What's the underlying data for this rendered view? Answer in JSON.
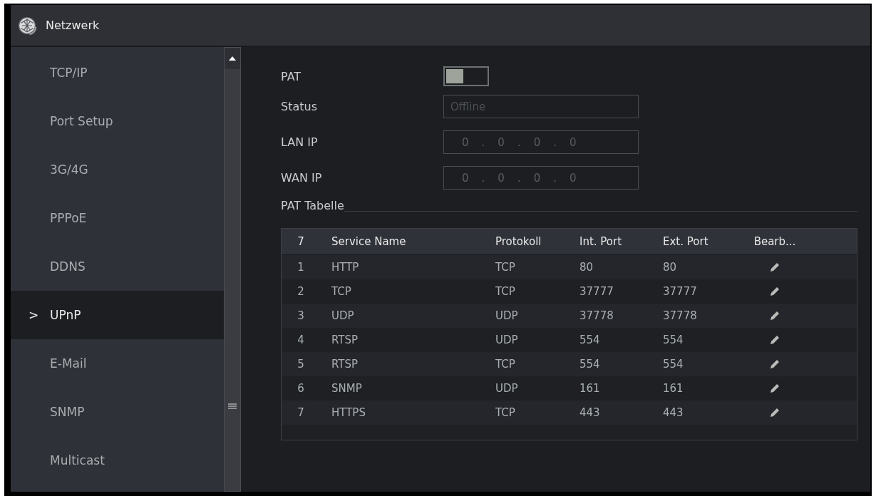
{
  "window": {
    "title": "Netzwerk"
  },
  "sidebar": {
    "items": [
      {
        "label": "TCP/IP",
        "selected": false
      },
      {
        "label": "Port Setup",
        "selected": false
      },
      {
        "label": "3G/4G",
        "selected": false
      },
      {
        "label": "PPPoE",
        "selected": false
      },
      {
        "label": "DDNS",
        "selected": false
      },
      {
        "label": "UPnP",
        "selected": true,
        "marker": ">"
      },
      {
        "label": "E-Mail",
        "selected": false
      },
      {
        "label": "SNMP",
        "selected": false
      },
      {
        "label": "Multicast",
        "selected": false
      }
    ]
  },
  "form": {
    "pat": {
      "label": "PAT",
      "on": false
    },
    "status": {
      "label": "Status",
      "placeholder": "Offline"
    },
    "lan_ip": {
      "label": "LAN IP",
      "octets": [
        "0",
        "0",
        "0",
        "0"
      ],
      "separator": "."
    },
    "wan_ip": {
      "label": "WAN IP",
      "octets": [
        "0",
        "0",
        "0",
        "0"
      ],
      "separator": "."
    }
  },
  "pat_table": {
    "title": "PAT Tabelle",
    "columns": [
      "7",
      "Service Name",
      "Protokoll",
      "Int. Port",
      "Ext. Port",
      "Bearb..."
    ],
    "rows": [
      [
        "1",
        "HTTP",
        "TCP",
        "80",
        "80"
      ],
      [
        "2",
        "TCP",
        "TCP",
        "37777",
        "37777"
      ],
      [
        "3",
        "UDP",
        "UDP",
        "37778",
        "37778"
      ],
      [
        "4",
        "RTSP",
        "UDP",
        "554",
        "554"
      ],
      [
        "5",
        "RTSP",
        "TCP",
        "554",
        "554"
      ],
      [
        "6",
        "SNMP",
        "UDP",
        "161",
        "161"
      ],
      [
        "7",
        "HTTPS",
        "TCP",
        "443",
        "443"
      ]
    ]
  }
}
